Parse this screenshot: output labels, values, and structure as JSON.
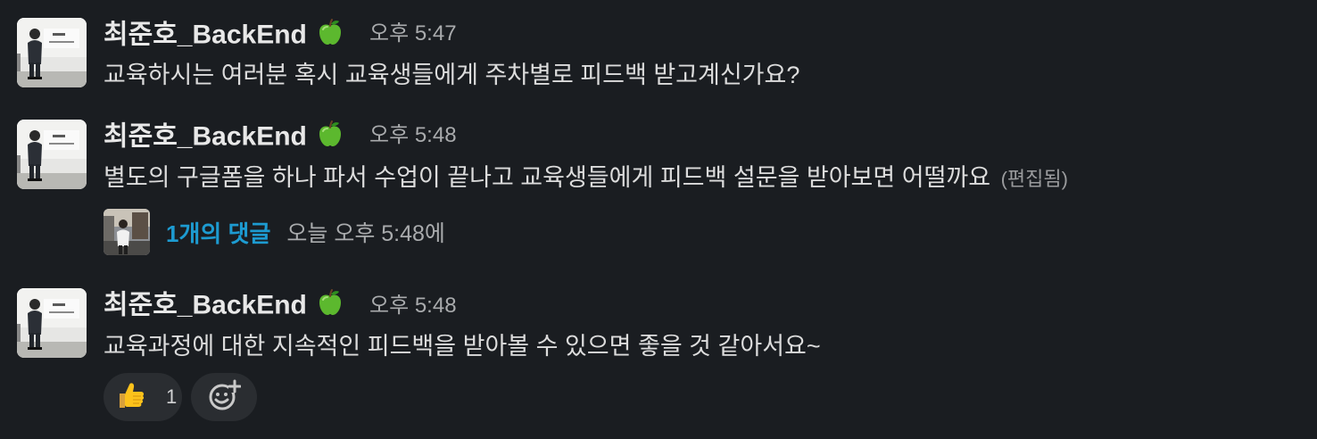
{
  "messages": [
    {
      "author": "최준호_BackEnd",
      "author_badge": "green-apple-emoji",
      "time": "오후 5:47",
      "text": "교육하시는 여러분 혹시 교육생들에게 주차별로 피드백 받고계신가요?"
    },
    {
      "author": "최준호_BackEnd",
      "author_badge": "green-apple-emoji",
      "time": "오후 5:48",
      "text": "별도의 구글폼을 하나 파서 수업이 끝나고 교육생들에게 피드백 설문을 받아보면 어떨까요",
      "edited_label": "(편집됨)",
      "thread": {
        "replies_label": "1개의 댓글",
        "last_reply_time": "오늘 오후 5:48에"
      }
    },
    {
      "author": "최준호_BackEnd",
      "author_badge": "green-apple-emoji",
      "time": "오후 5:48",
      "text": "교육과정에 대한 지속적인 피드백을 받아볼 수 있으면 좋을 것 같아서요~",
      "reactions": [
        {
          "emoji": "thumbs-up-emoji",
          "count": "1"
        }
      ],
      "add_reaction_icon": "add-reaction-icon"
    }
  ],
  "colors": {
    "background": "#1a1d21",
    "link": "#1d9bd1",
    "reaction_bg": "#2a2d31"
  }
}
